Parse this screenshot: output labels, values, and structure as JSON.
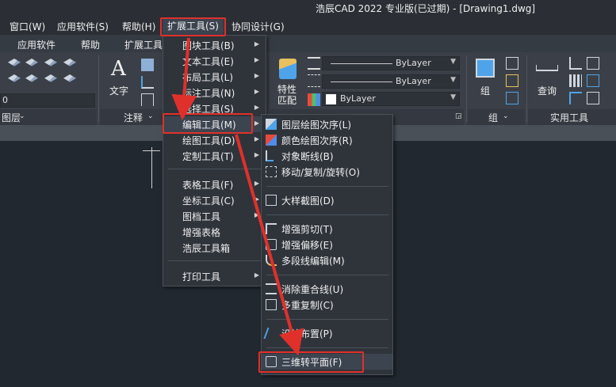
{
  "title_bar": {
    "title": "浩辰CAD 2022 专业版(已过期) - [Drawing1.dwg]"
  },
  "menubar": {
    "items": [
      {
        "label": "窗口(W)"
      },
      {
        "label": "应用软件(S)"
      },
      {
        "label": "帮助(H)"
      },
      {
        "label": "扩展工具(S)"
      },
      {
        "label": "协同设计(G)"
      }
    ]
  },
  "ribbon_tabs": [
    {
      "label": "应用软件"
    },
    {
      "label": "帮助"
    },
    {
      "label": "扩展工具"
    }
  ],
  "ribbon": {
    "layer_value": "0",
    "layer_footer": "图层",
    "text_label": "文字",
    "annotation_footer": "注释",
    "property_match_label": "特性\n匹配",
    "bylayer_1": "ByLayer",
    "bylayer_2": "ByLayer",
    "bylayer_3": "ByLayer",
    "group_label": "组",
    "group_footer": "组",
    "query_label": "查询",
    "utility_footer": "实用工具"
  },
  "ext_menu": {
    "items": [
      {
        "label": "图块工具(B)",
        "sub": true
      },
      {
        "label": "文本工具(E)",
        "sub": true
      },
      {
        "label": "布局工具(L)",
        "sub": true
      },
      {
        "label": "标注工具(N)",
        "sub": true
      },
      {
        "label": "选择工具(S)",
        "sub": true
      },
      {
        "label": "编辑工具(M)",
        "sub": true
      },
      {
        "label": "绘图工具(D)",
        "sub": true
      },
      {
        "label": "定制工具(T)",
        "sub": true
      },
      {
        "label": "表格工具(F)",
        "sub": true
      },
      {
        "label": "坐标工具(C)",
        "sub": true
      },
      {
        "label": "图档工具",
        "sub": true
      },
      {
        "label": "增强表格",
        "sub": false
      },
      {
        "label": "浩辰工具箱",
        "sub": false
      },
      {
        "label": "打印工具",
        "sub": true
      }
    ]
  },
  "edit_menu": {
    "items": [
      {
        "label": "图层绘图次序(L)"
      },
      {
        "label": "颜色绘图次序(R)"
      },
      {
        "label": "对象断线(B)"
      },
      {
        "label": "移动/复制/旋转(O)"
      },
      {
        "label": "大样截图(D)"
      },
      {
        "label": "增强剪切(T)"
      },
      {
        "label": "增强偏移(E)"
      },
      {
        "label": "多段线编辑(M)"
      },
      {
        "label": "消除重合线(U)"
      },
      {
        "label": "多重复制(C)"
      },
      {
        "label": "沿线布置(P)"
      },
      {
        "label": "三维转平面(F)"
      }
    ]
  },
  "colors": {
    "highlight_red": "#e0302b",
    "menu_bg": "#2f343b",
    "workspace_bg": "#212830"
  }
}
